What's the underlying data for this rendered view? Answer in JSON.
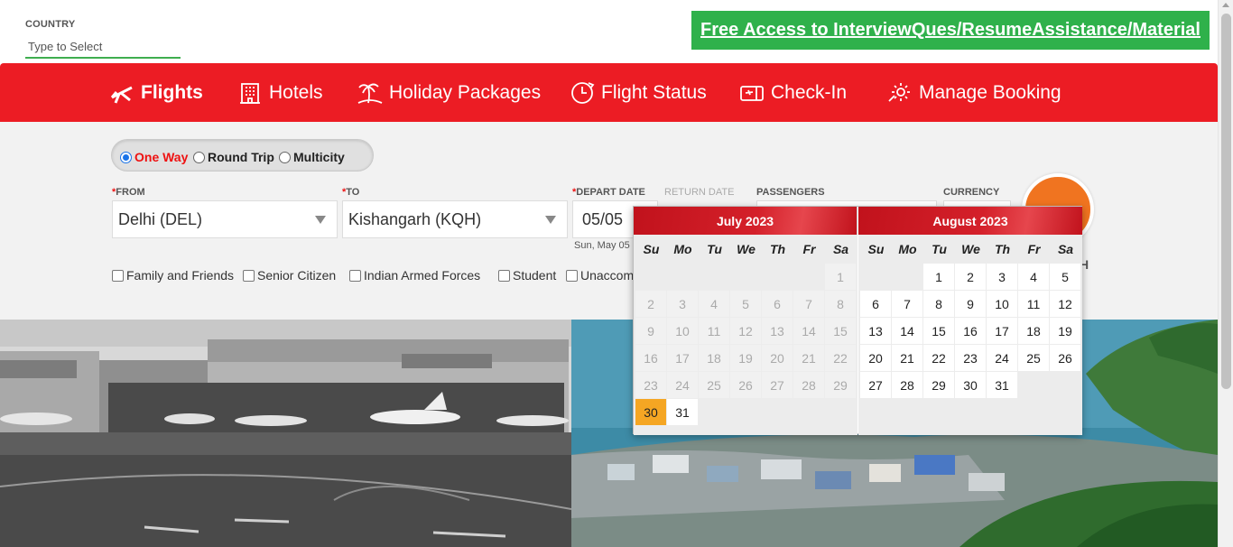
{
  "country": {
    "label": "COUNTRY",
    "placeholder": "Type to Select"
  },
  "promo": {
    "text": "Free Access to InterviewQues/ResumeAssistance/Material"
  },
  "nav": {
    "items": [
      {
        "label": "Flights",
        "icon": "plane-icon"
      },
      {
        "label": "Hotels",
        "icon": "hotel-icon"
      },
      {
        "label": "Holiday Packages",
        "icon": "palm-tree-icon"
      },
      {
        "label": "Flight Status",
        "icon": "clock-plane-icon"
      },
      {
        "label": "Check-In",
        "icon": "ticket-icon"
      },
      {
        "label": "Manage Booking",
        "icon": "gear-icon"
      }
    ]
  },
  "trip": {
    "one_way": "One Way",
    "round_trip": "Round Trip",
    "multicity": "Multicity",
    "selected": "One Way"
  },
  "form": {
    "from_label": "FROM",
    "to_label": "TO",
    "depart_label": "DEPART DATE",
    "return_label": "RETURN DATE",
    "passengers_label": "PASSENGERS",
    "currency_label": "CURRENCY",
    "from_value": "Delhi (DEL)",
    "to_value": "Kishangarh (KQH)",
    "depart_value": "05/05",
    "depart_sub": "Sun, May 05",
    "search_fragment": "H"
  },
  "concessions": {
    "family": "Family and Friends",
    "senior": "Senior Citizen",
    "armed": "Indian Armed Forces",
    "student": "Student",
    "unaccompanied": "Unaccom"
  },
  "calendar": {
    "dow": [
      "Su",
      "Mo",
      "Tu",
      "We",
      "Th",
      "Fr",
      "Sa"
    ],
    "months": [
      {
        "title": "July 2023",
        "first_dow": 6,
        "days": 31,
        "enabled_from": 30,
        "selected": 30
      },
      {
        "title": "August 2023",
        "first_dow": 2,
        "days": 31,
        "enabled_from": 1,
        "selected": null
      }
    ]
  }
}
